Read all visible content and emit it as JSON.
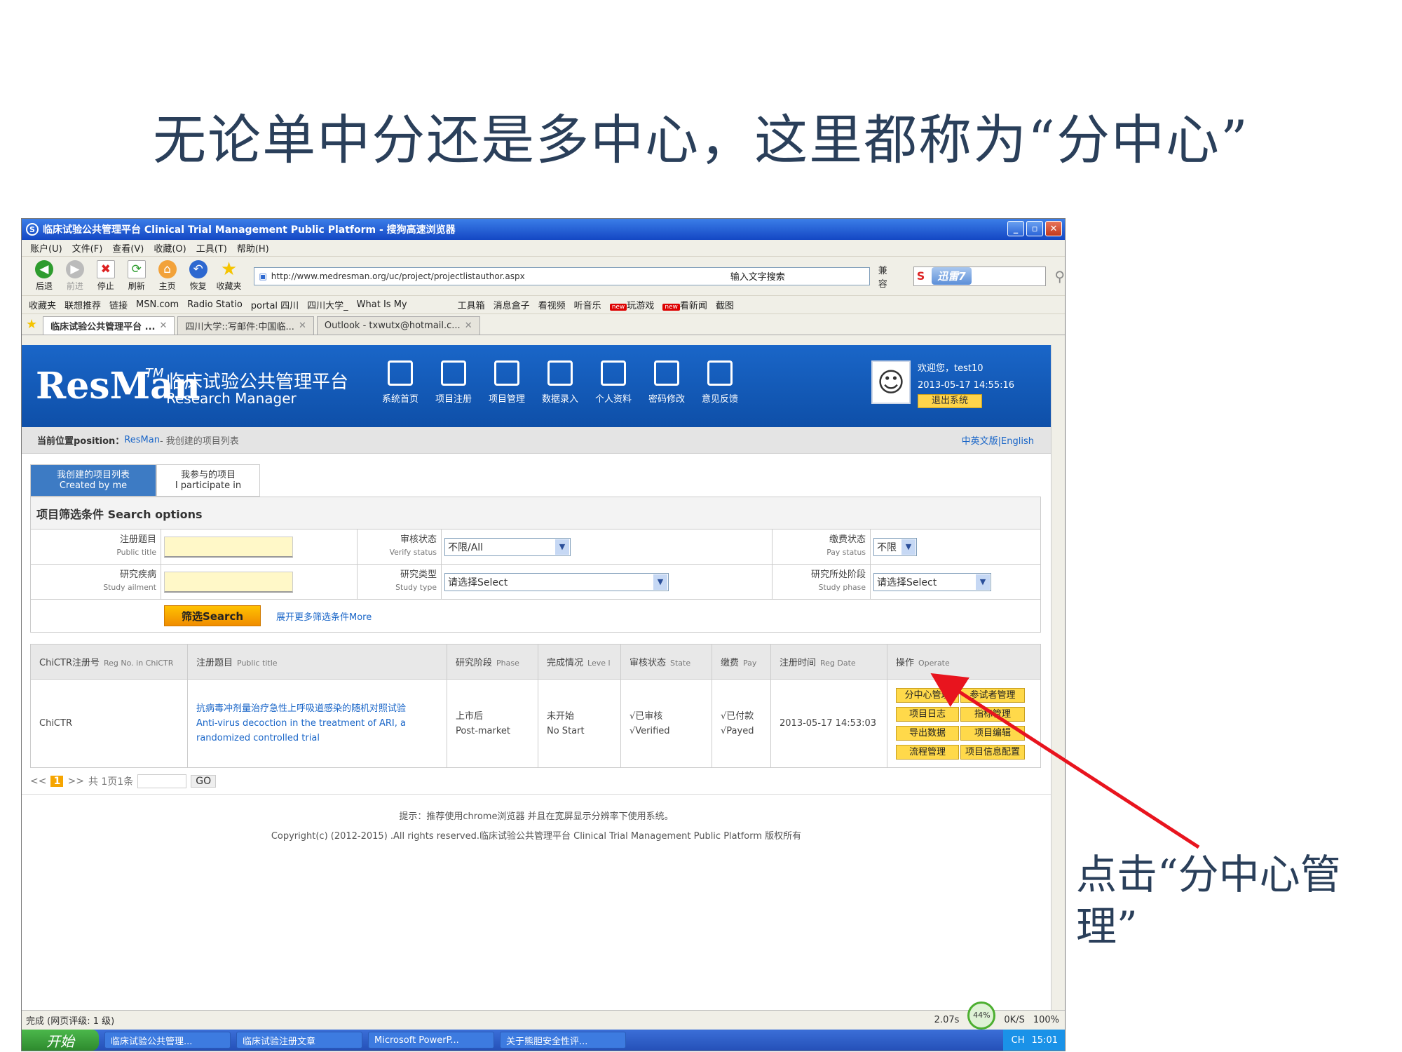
{
  "slide": {
    "title": "无论单中分还是多中心，这里都称为“分中心”",
    "callout": "点击“分中心管理”"
  },
  "browser": {
    "title": "临床试验公共管理平台 Clinical Trial Management Public Platform - 搜狗高速浏览器",
    "menu": [
      "账户(U)",
      "文件(F)",
      "查看(V)",
      "收藏(O)",
      "工具(T)",
      "帮助(H)"
    ],
    "toolbar": [
      "后退",
      "前进",
      "停止",
      "刷新",
      "主页",
      "恢复",
      "收藏夹"
    ],
    "url": "http://www.medresman.org/uc/project/projectlistauthor.aspx",
    "search_label": "输入文字搜索",
    "compat": "兼容",
    "xunlei": "迅雷7",
    "favorites": [
      "收藏夹",
      "联想推荐",
      "链接",
      "MSN.com",
      "Radio Statio",
      "portal 四川",
      "四川大学_",
      "What Is My",
      "工具箱",
      "消息盒子",
      "看视频",
      "听音乐",
      "new",
      "玩游戏",
      "new",
      "看新闻",
      "截图"
    ],
    "tabs": [
      "临床试验公共管理平台 ...",
      "四川大学::写邮件:中国临...",
      "Outlook - txwutx@hotmail.c..."
    ]
  },
  "site": {
    "brand": "ResMan",
    "tm": "TM",
    "name_cn": "临床试验公共管理平台",
    "name_en": "Research Manager",
    "nav": [
      "系统首页",
      "项目注册",
      "项目管理",
      "数据录入",
      "个人资料",
      "密码修改",
      "意见反馈"
    ],
    "welcome": "欢迎您，test10",
    "datetime": "2013-05-17 14:55:16",
    "logout": "退出系统",
    "crumb_label": "当前位置position：",
    "crumb_link": "ResMan",
    "crumb_rest": " - 我创建的项目列表",
    "lang": "中英文版|English",
    "tab_created_cn": "我创建的项目列表",
    "tab_created_en": "Created by me",
    "tab_part_cn": "我参与的项目",
    "tab_part_en": "I participate in",
    "filter_title": "项目筛选条件 Search options",
    "f_title_cn": "注册题目",
    "f_title_en": "Public title",
    "f_verify_cn": "审核状态",
    "f_verify_en": "Verify status",
    "f_verify_val": "不限/All",
    "f_pay_cn": "缴费状态",
    "f_pay_en": "Pay status",
    "f_pay_val": "不限",
    "f_ailment_cn": "研究疾病",
    "f_ailment_en": "Study ailment",
    "f_type_cn": "研究类型",
    "f_type_en": "Study type",
    "f_type_val": "请选择Select",
    "f_phase_cn": "研究所处阶段",
    "f_phase_en": "Study phase",
    "f_phase_val": "请选择Select",
    "search_btn": "筛选Search",
    "more": "展开更多筛选条件More",
    "columns": [
      {
        "cn": "ChiCTR注册号",
        "en": "Reg No. in ChiCTR"
      },
      {
        "cn": "注册题目",
        "en": "Public title"
      },
      {
        "cn": "研究阶段",
        "en": "Phase"
      },
      {
        "cn": "完成情况",
        "en": "Leve l"
      },
      {
        "cn": "审核状态",
        "en": "State"
      },
      {
        "cn": "缴费",
        "en": "Pay"
      },
      {
        "cn": "注册时间",
        "en": "Reg Date"
      },
      {
        "cn": "操作",
        "en": "Operate"
      }
    ],
    "row": {
      "reg": "ChiCTR",
      "title_cn": "抗病毒冲剂量治疗急性上呼吸道感染的随机对照试验",
      "title_en": "Anti-virus decoction in the treatment of ARI, a randomized controlled trial",
      "phase_cn": "上市后",
      "phase_en": "Post-market",
      "level_cn": "未开始",
      "level_en": "No Start",
      "state_cn": "√已审核",
      "state_en": "√Verified",
      "pay_cn": "√已付款",
      "pay_en": "√Payed",
      "date": "2013-05-17 14:53:03",
      "ops": [
        "分中心管理",
        "参试者管理",
        "项目日志",
        "指标管理",
        "导出数据",
        "项目编辑",
        "流程管理",
        "项目信息配置"
      ]
    },
    "pager": {
      "prev": "<<",
      "page": "1",
      "next": ">>",
      "info": "共 1页1条",
      "go": "GO"
    },
    "footer_tip": "提示：推荐使用chrome浏览器 并且在宽屏显示分辨率下使用系统。",
    "footer_copy": "Copyright(c) (2012-2015) .All rights reserved.临床试验公共管理平台 Clinical Trial Management Public Platform 版权所有"
  },
  "status": {
    "done": "完成 (网页评级: 1 级)",
    "speed": "2.07s",
    "gauge": "44%",
    "net": "0K/S",
    "zoom": "100%"
  },
  "taskbar": {
    "start": "开始",
    "tasks": [
      "临床试验公共管理...",
      "临床试验注册文章",
      "Microsoft PowerP...",
      "关于熊胆安全性评..."
    ],
    "lang": "CH",
    "time": "15:01"
  },
  "colors": {
    "header_blue": "#1a66c8",
    "accent_yellow": "#ffd94a",
    "arrow_red": "#e8141e",
    "title_text": "#2a3f5a"
  }
}
